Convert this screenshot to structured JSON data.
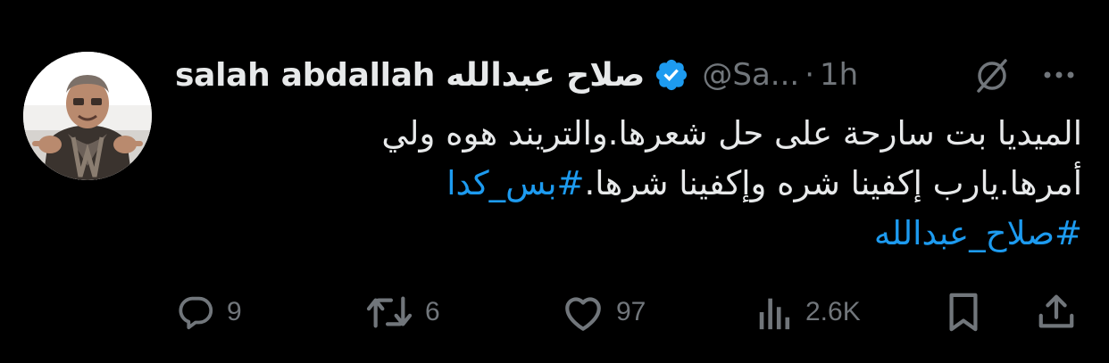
{
  "tweet": {
    "display_name": "salah abdallah صلاح عبدالله",
    "handle": "@Sa...",
    "separator": "·",
    "time": "1h",
    "text_line_1": "الميديا بت سارحة على حل شعرها.والتريند هوه ولي",
    "text_line_2_plain": "أمرها.يارب إكفينا شره وإكفينا شرها.",
    "hashtag_1": "#بس_كدا",
    "hashtag_2": "#صلاح_عبدالله",
    "verified_color": "#1d9bf0"
  },
  "actions": {
    "replies": "9",
    "reposts": "6",
    "likes": "97",
    "views": "2.6K"
  },
  "colors": {
    "background": "#000000",
    "text": "#e7e9ea",
    "secondary": "#71767b",
    "accent": "#1d9bf0"
  },
  "icons": [
    "verified-badge-icon",
    "grok-icon",
    "more-icon",
    "reply-icon",
    "repost-icon",
    "like-icon",
    "views-icon",
    "bookmark-icon",
    "share-icon"
  ]
}
